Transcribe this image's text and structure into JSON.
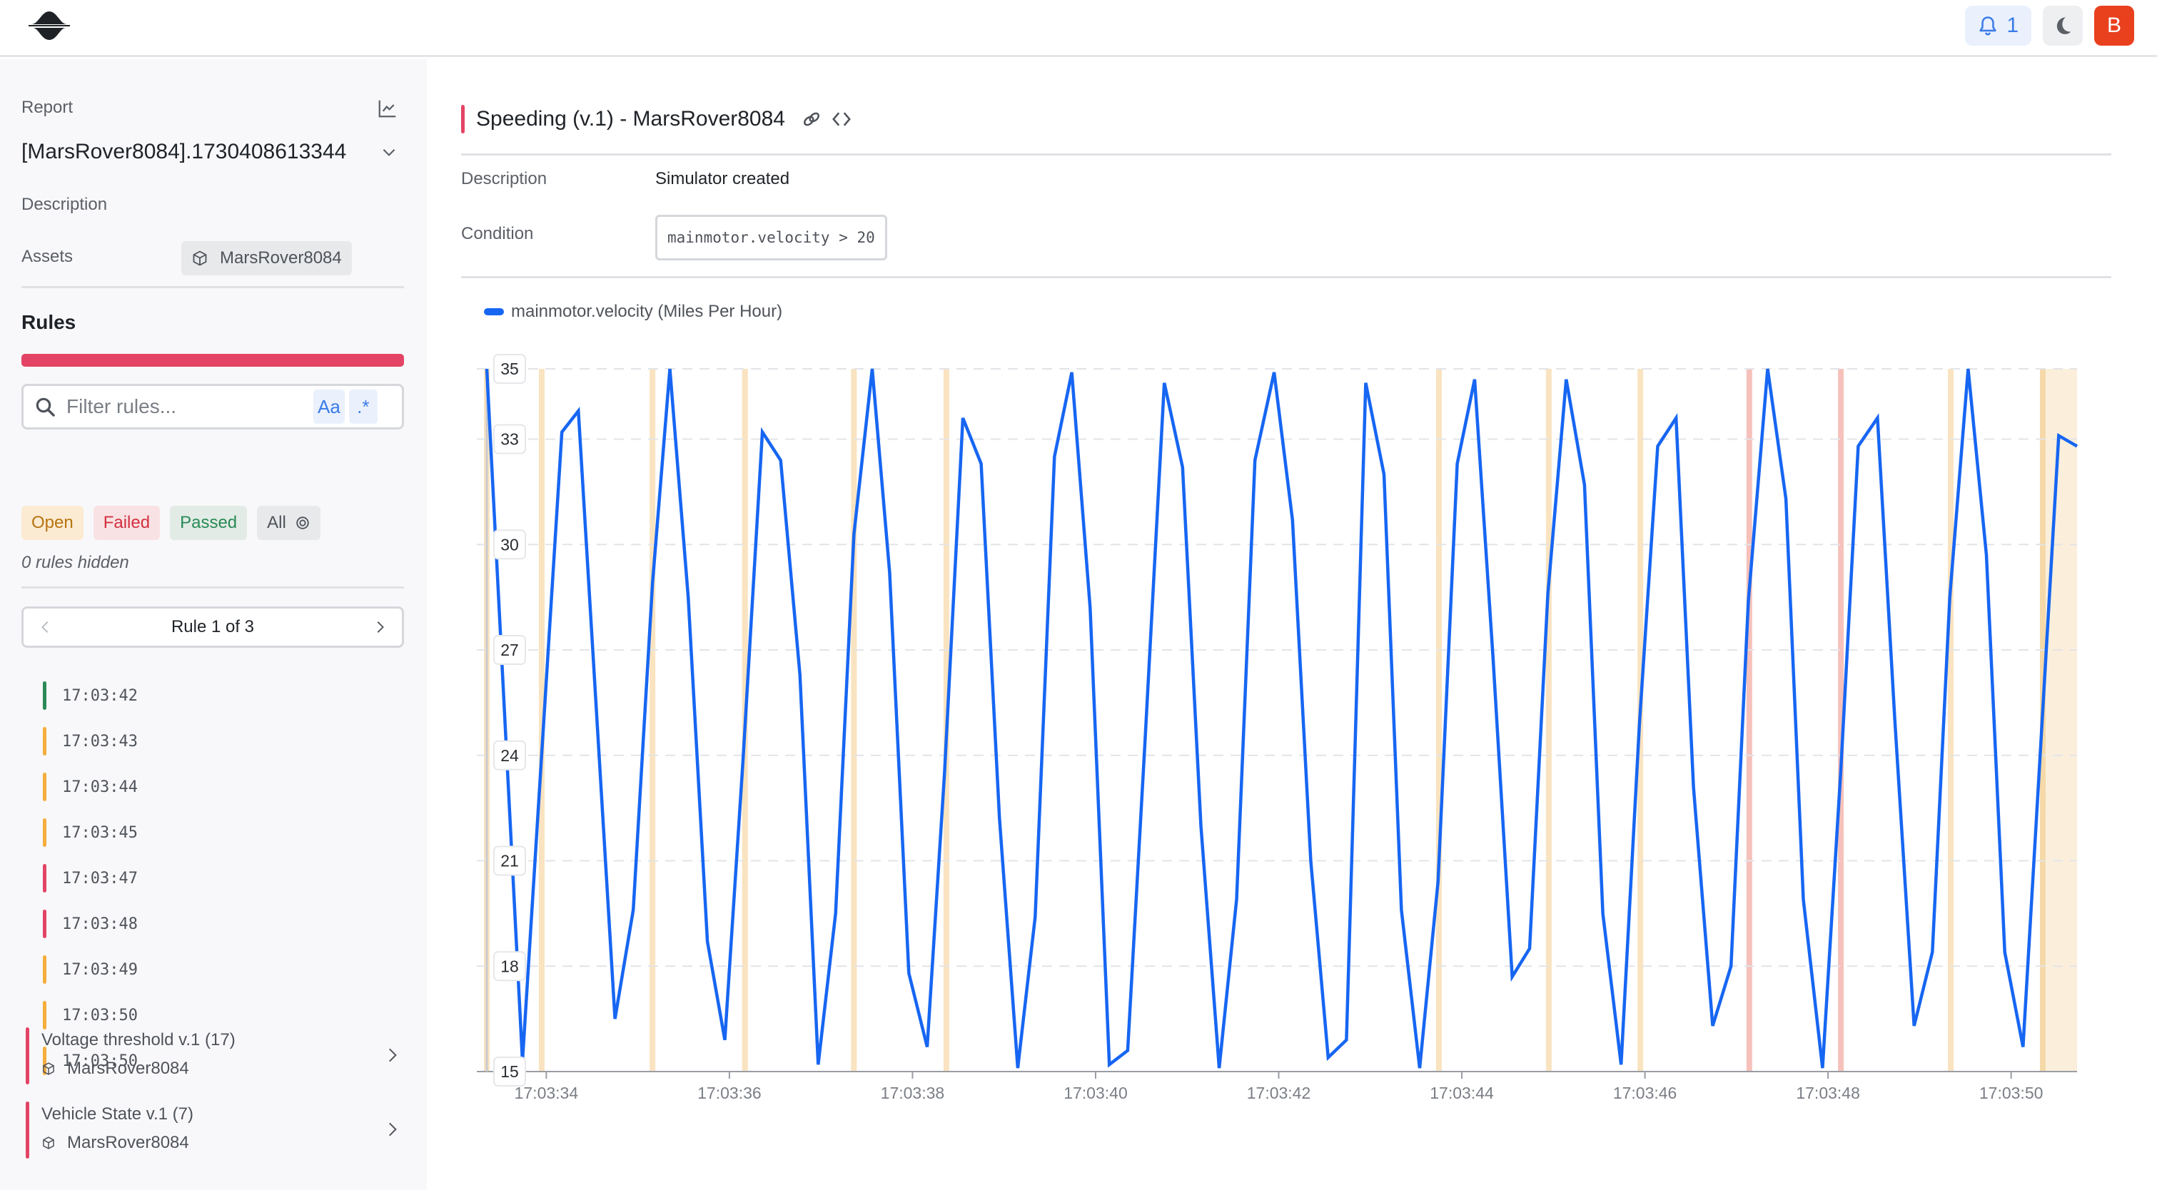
{
  "topbar": {
    "logo": "app-logo",
    "notifications": {
      "icon": "bell-icon",
      "count": "1"
    },
    "theme_toggle_icon": "moon-icon",
    "user_initial": "B",
    "accent_color": "#e9401e"
  },
  "sidebar": {
    "report_label": "Report",
    "report_icon": "line-chart-icon",
    "report_name": "[MarsRover8084].1730408613344",
    "description_label": "Description",
    "assets_label": "Assets",
    "asset_name": "MarsRover8084",
    "rules_title": "Rules",
    "rules_bar_color": "#e34465",
    "filter": {
      "placeholder": "Filter rules...",
      "value": "",
      "case_toggle": "Aa",
      "regex_toggle": ".*"
    },
    "status_filters": [
      {
        "label": "Open",
        "status": "open"
      },
      {
        "label": "Failed",
        "status": "failed"
      },
      {
        "label": "Passed",
        "status": "passed"
      },
      {
        "label": "All",
        "status": "all",
        "icon": "eye-icon"
      }
    ],
    "hidden_note": "0 rules hidden",
    "pager": {
      "label": "Rule 1 of 3",
      "current": 1,
      "total": 3
    },
    "occurrences": [
      {
        "time": "17:03:42",
        "status": "passed",
        "color": "#2a8a56"
      },
      {
        "time": "17:03:43",
        "status": "open",
        "color": "#f5ad3c"
      },
      {
        "time": "17:03:44",
        "status": "open",
        "color": "#f5ad3c"
      },
      {
        "time": "17:03:45",
        "status": "open",
        "color": "#f5ad3c"
      },
      {
        "time": "17:03:47",
        "status": "failed",
        "color": "#e34465"
      },
      {
        "time": "17:03:48",
        "status": "failed",
        "color": "#e34465"
      },
      {
        "time": "17:03:49",
        "status": "open",
        "color": "#f5ad3c"
      },
      {
        "time": "17:03:50",
        "status": "open",
        "color": "#f5ad3c"
      },
      {
        "time": "17:03:50",
        "status": "open",
        "color": "#f5ad3c"
      }
    ],
    "other_rules": [
      {
        "name": "Voltage threshold v.1 (17)",
        "asset": "MarsRover8084"
      },
      {
        "name": "Vehicle State v.1 (7)",
        "asset": "MarsRover8084"
      }
    ]
  },
  "main": {
    "title": "Speeding (v.1) - MarsRover8084",
    "title_icons": [
      "link-icon",
      "code-icon"
    ],
    "description_label": "Description",
    "description_value": "Simulator created",
    "condition_label": "Condition",
    "condition_value": "mainmotor.velocity > 20"
  },
  "chart_data": {
    "type": "line",
    "title": "",
    "legend": [
      "mainmotor.velocity (Miles Per Hour)"
    ],
    "legend_position": "top-left",
    "series_color": "#1766f2",
    "xlabel": "",
    "ylabel": "",
    "x_unit": "seconds past 17:03:00",
    "x_range": [
      33.35,
      50.72
    ],
    "ylim": [
      15,
      35
    ],
    "yticks": [
      15,
      18,
      21,
      24,
      27,
      30,
      33,
      35
    ],
    "xticks": [
      {
        "value": 34,
        "label": "17:03:34"
      },
      {
        "value": 36,
        "label": "17:03:36"
      },
      {
        "value": 38,
        "label": "17:03:38"
      },
      {
        "value": 40,
        "label": "17:03:40"
      },
      {
        "value": 42,
        "label": "17:03:42"
      },
      {
        "value": 44,
        "label": "17:03:44"
      },
      {
        "value": 46,
        "label": "17:03:46"
      },
      {
        "value": 48,
        "label": "17:03:48"
      },
      {
        "value": 50,
        "label": "17:03:50"
      }
    ],
    "grid": "horizontal-dashed",
    "series": [
      {
        "name": "mainmotor.velocity (Miles Per Hour)",
        "x": [
          33.35,
          33.74,
          34.17,
          34.35,
          34.75,
          34.95,
          35.16,
          35.35,
          35.55,
          35.76,
          35.95,
          36.15,
          36.36,
          36.56,
          36.77,
          36.97,
          37.16,
          37.36,
          37.56,
          37.75,
          37.96,
          38.16,
          38.35,
          38.55,
          38.75,
          38.95,
          39.15,
          39.34,
          39.55,
          39.74,
          39.94,
          40.15,
          40.35,
          40.54,
          40.75,
          40.95,
          41.15,
          41.35,
          41.54,
          41.74,
          41.95,
          42.15,
          42.35,
          42.54,
          42.74,
          42.95,
          43.15,
          43.34,
          43.54,
          43.74,
          43.95,
          44.14,
          44.34,
          44.55,
          44.74,
          44.94,
          45.14,
          45.34,
          45.54,
          45.74,
          45.94,
          46.14,
          46.34,
          46.53,
          46.74,
          46.94,
          47.13,
          47.34,
          47.54,
          47.73,
          47.94,
          48.14,
          48.33,
          48.54,
          48.73,
          48.94,
          49.14,
          49.33,
          49.53,
          49.73,
          49.93,
          50.13,
          50.33,
          50.52,
          50.72
        ],
        "y": [
          35,
          15.3,
          33.2,
          33.8,
          16.5,
          19.6,
          28.9,
          35,
          28.5,
          18.7,
          15.9,
          23.9,
          33.2,
          32.4,
          26.3,
          15.2,
          19.5,
          30.3,
          35,
          29.2,
          17.8,
          15.7,
          23.5,
          33.6,
          32.3,
          22.2,
          15.1,
          19.4,
          32.5,
          34.9,
          28.2,
          15.2,
          15.6,
          24.4,
          34.6,
          32.2,
          22.0,
          15.1,
          19.9,
          32.4,
          34.9,
          30.7,
          21.0,
          15.4,
          15.9,
          34.6,
          32.0,
          19.6,
          15.1,
          20.4,
          32.3,
          34.7,
          26.8,
          17.7,
          18.5,
          28.6,
          34.7,
          31.7,
          19.5,
          15.2,
          24.9,
          32.8,
          33.6,
          23.1,
          16.3,
          18.0,
          28.4,
          35,
          31.3,
          19.9,
          15.1,
          23.6,
          32.8,
          33.6,
          25.0,
          16.3,
          18.4,
          28.5,
          35,
          29.7,
          18.4,
          15.7,
          24.6,
          33.1,
          32.8
        ]
      }
    ],
    "annotations": [
      {
        "type": "open",
        "color": "#f9e3c0",
        "start": 33.35,
        "end": 33.35
      },
      {
        "type": "open",
        "color": "#f9e3c0",
        "start": 33.95,
        "end": 33.95
      },
      {
        "type": "open",
        "color": "#f9e3c0",
        "start": 35.16,
        "end": 35.16
      },
      {
        "type": "open",
        "color": "#f9e3c0",
        "start": 36.17,
        "end": 36.17
      },
      {
        "type": "open",
        "color": "#f9e3c0",
        "start": 37.36,
        "end": 37.36
      },
      {
        "type": "open",
        "color": "#f9e3c0",
        "start": 38.37,
        "end": 38.37
      },
      {
        "type": "open",
        "color": "#f9e3c0",
        "start": 43.75,
        "end": 43.75
      },
      {
        "type": "open",
        "color": "#f9e3c0",
        "start": 44.95,
        "end": 44.95
      },
      {
        "type": "open",
        "color": "#f9e3c0",
        "start": 45.95,
        "end": 45.95
      },
      {
        "type": "failed",
        "color": "#f6c1bb",
        "start": 47.14,
        "end": 47.14
      },
      {
        "type": "failed",
        "color": "#f6c1bb",
        "start": 48.14,
        "end": 48.14
      },
      {
        "type": "open",
        "color": "#f9e3c0",
        "start": 49.34,
        "end": 49.34
      },
      {
        "type": "open-range",
        "color": "#fbefdc",
        "start": 50.33,
        "end": 50.72
      }
    ]
  }
}
